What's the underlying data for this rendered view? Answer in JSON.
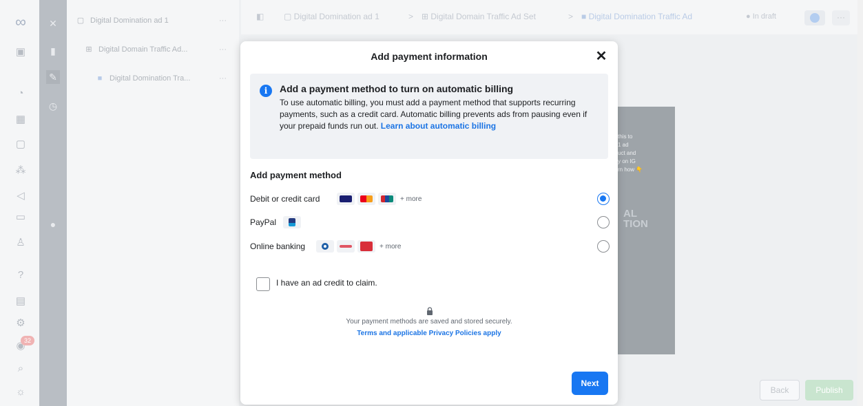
{
  "colors": {
    "accent": "#1877f2",
    "link": "#1b74e4",
    "info_bg": "#f0f2f5",
    "publish_bg": "#c9e5cf",
    "rail_badge_bg": "#f0b3b3"
  },
  "rail": {
    "logo_icon": "meta-infinity-logo",
    "icons": [
      "account-avatar-icon",
      "dashboard-icon",
      "campaigns-table-icon",
      "catalog-icon",
      "audiences-icon",
      "megaphone-icon",
      "billing-icon",
      "people-icon",
      "help-icon",
      "pages-icon",
      "settings-icon",
      "notifications-icon",
      "search-icon",
      "bug-icon"
    ],
    "notification_count": "32"
  },
  "tools": {
    "icons": [
      "close-icon",
      "chart-icon",
      "edit-icon",
      "history-icon",
      "dot-icon"
    ]
  },
  "tree": {
    "items": [
      {
        "label": "Digital Domination ad 1",
        "icon": "folder-icon"
      },
      {
        "label": "Digital Domain Traffic Ad...",
        "icon": "adset-grid-icon"
      },
      {
        "label": "Digital Domination Tra...",
        "icon": "ad-icon"
      }
    ],
    "more": "···"
  },
  "breadcrumb": {
    "campaign": "Digital Domination ad 1",
    "adset": "Digital Domain Traffic Ad Set",
    "ad": "Digital Domination Traffic Ad",
    "separator": ">",
    "status": "In draft",
    "more": "···"
  },
  "preview": {
    "lines": [
      "this to",
      "1 ad",
      "uct and",
      "y on IG",
      "rn how 👇"
    ],
    "big_text_1": "AL",
    "big_text_2": "TION"
  },
  "footer": {
    "back_label": "Back",
    "publish_label": "Publish"
  },
  "modal": {
    "title": "Add payment information",
    "close_icon": "close-icon",
    "info": {
      "title": "Add a payment method to turn on automatic billing",
      "body": "To use automatic billing, you must add a payment method that supports recurring payments, such as a credit card. Automatic billing prevents ads from pausing even if your prepaid funds run out.",
      "link": "Learn about automatic billing"
    },
    "section_title": "Add payment method",
    "methods": [
      {
        "label": "Debit or credit card",
        "chips": [
          "visa-icon",
          "mastercard-icon",
          "unionpay-icon"
        ],
        "more": "+ more",
        "selected": true
      },
      {
        "label": "PayPal",
        "chips": [
          "paypal-icon"
        ],
        "more": "",
        "selected": false
      },
      {
        "label": "Online banking",
        "chips": [
          "bank-circle-icon",
          "bank-arrow-icon",
          "bank-red-icon"
        ],
        "more": "+ more",
        "selected": false
      }
    ],
    "ad_credit_label": "I have an ad credit to claim.",
    "ad_credit_checked": false,
    "secure_text": "Your payment methods are saved and stored securely.",
    "secure_link": "Terms and applicable Privacy Policies apply",
    "next_label": "Next"
  }
}
